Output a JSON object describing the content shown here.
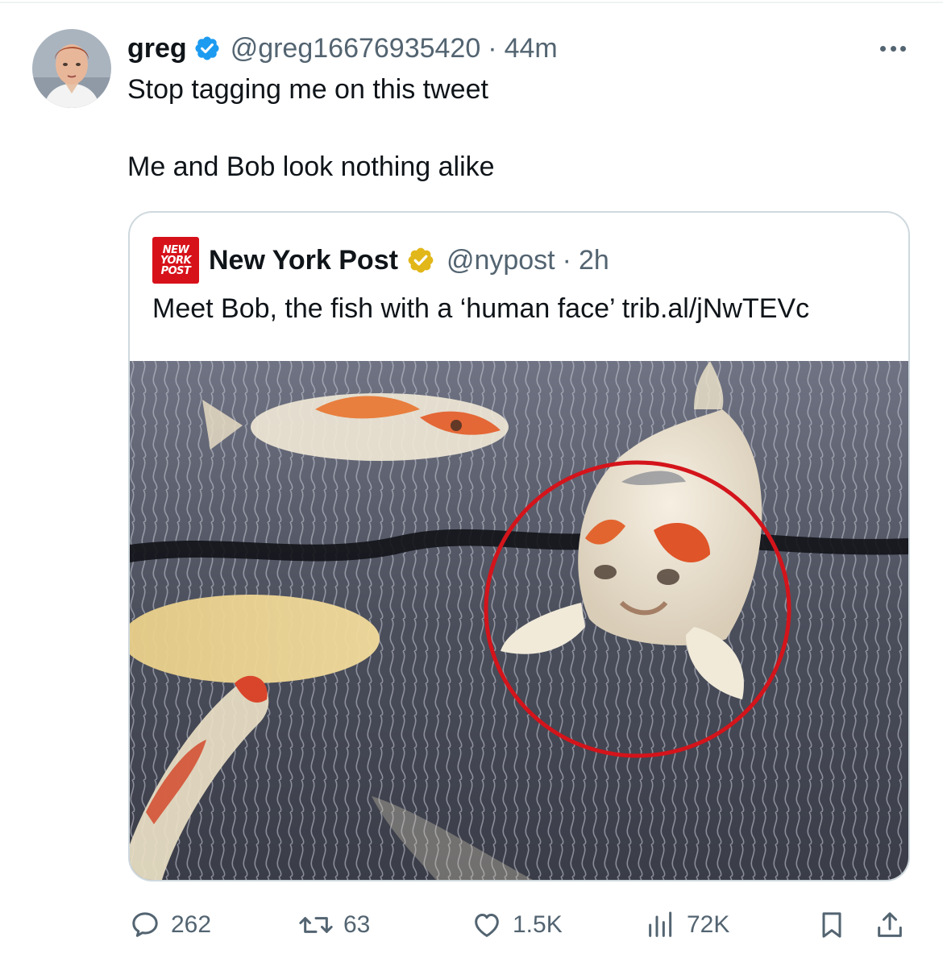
{
  "tweet": {
    "author_name": "greg",
    "author_handle": "@greg16676935420",
    "separator": "·",
    "time": "44m",
    "text_line1": "Stop tagging me on this tweet",
    "text_line2": "Me and Bob look nothing alike"
  },
  "quote": {
    "logo_lines": [
      "NEW",
      "YORK",
      "POST"
    ],
    "author_name": "New York Post",
    "author_handle": "@nypost",
    "separator": "·",
    "time": "2h",
    "text": "Meet Bob, the fish with a ‘human face’ trib.al/jNwTEVc"
  },
  "actions": {
    "replies": "262",
    "reposts": "63",
    "likes": "1.5K",
    "views": "72K"
  },
  "colors": {
    "verified_blue": "#1d9bf0",
    "gold_verified": "#e2b719",
    "nypost_red": "#d7111a",
    "muted_text": "#536471",
    "circle_highlight": "#d4141b"
  },
  "icons": [
    "verified-badge-icon",
    "gold-verified-badge-icon",
    "more-icon",
    "reply-icon",
    "repost-icon",
    "like-icon",
    "views-icon",
    "bookmark-icon",
    "share-icon"
  ]
}
